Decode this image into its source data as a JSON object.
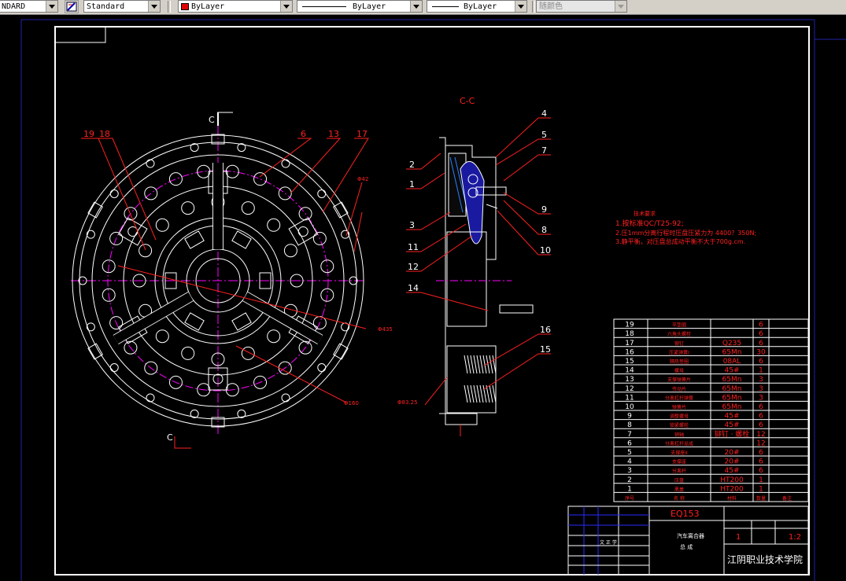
{
  "toolbar": {
    "text_style": "NDARD",
    "dim_style": "Standard",
    "layer_color": "ByLayer",
    "linetype": "ByLayer",
    "lineweight": "ByLayer",
    "plot_style": "随颜色"
  },
  "drawing": {
    "section_label": "C-C",
    "cut_label_top": "C",
    "cut_label_bottom": "C",
    "callouts_front": [
      "19",
      "18",
      "6",
      "13",
      "17"
    ],
    "callouts_section_left": [
      "2",
      "1",
      "3",
      "11",
      "12",
      "14"
    ],
    "callouts_section_right": [
      "4",
      "5",
      "7",
      "9",
      "8",
      "10",
      "16",
      "15"
    ],
    "dims": [
      "Φ435",
      "Φ160",
      "Φ83.25",
      "Φ42"
    ],
    "tech_notes_title": "技术要求",
    "tech_notes": [
      "1.按标准QC/T25-92;",
      "2.压1mm分离行程时压盘压紧力为 4400？350N;",
      "3.静平衡，对压盘总成动平衡不大于700g.cm."
    ]
  },
  "parts_list": {
    "rows": [
      {
        "no": "19",
        "name": "平垫圈",
        "material": "",
        "qty": "6"
      },
      {
        "no": "18",
        "name": "六角头螺栓",
        "material": "",
        "qty": "6"
      },
      {
        "no": "17",
        "name": "铆钉",
        "material": "Q235",
        "qty": "6"
      },
      {
        "no": "16",
        "name": "压紧弹簧I",
        "material": "65Mn",
        "qty": "30"
      },
      {
        "no": "15",
        "name": "隔热垫圈",
        "material": "08AL",
        "qty": "6"
      },
      {
        "no": "14",
        "name": "螺母",
        "material": "45#",
        "qty": "1"
      },
      {
        "no": "13",
        "name": "支撑弹簧片",
        "material": "65Mn",
        "qty": "3"
      },
      {
        "no": "12",
        "name": "传动片",
        "material": "65Mn",
        "qty": "3"
      },
      {
        "no": "11",
        "name": "分离杠杆弹簧",
        "material": "65Mn",
        "qty": "3"
      },
      {
        "no": "10",
        "name": "弹簧片",
        "material": "65Mn",
        "qty": "6"
      },
      {
        "no": "9",
        "name": "调整螺母",
        "material": "45#",
        "qty": "6"
      },
      {
        "no": "8",
        "name": "锁紧螺栓",
        "material": "45#",
        "qty": "6"
      },
      {
        "no": "7",
        "name": "销轴",
        "material": "铆钉 · 螺栓",
        "qty": "12"
      },
      {
        "no": "6",
        "name": "分离杠杆总成",
        "material": "",
        "qty": "12"
      },
      {
        "no": "5",
        "name": "支撑座II",
        "material": "20#",
        "qty": "6"
      },
      {
        "no": "4",
        "name": "支撑座",
        "material": "20#",
        "qty": "6"
      },
      {
        "no": "3",
        "name": "分离杆",
        "material": "45#",
        "qty": "6"
      },
      {
        "no": "2",
        "name": "压盘",
        "material": "HT200",
        "qty": "1"
      },
      {
        "no": "1",
        "name": "离盖",
        "material": "HT200",
        "qty": "1"
      }
    ],
    "header": [
      "序号",
      "名 称",
      "材料",
      "数量",
      "备注"
    ]
  },
  "title_block": {
    "drawing_no": "EQ153",
    "part_name": "汽车离合器",
    "part_sub": "总 成",
    "scale": "1",
    "sheet": "1:2",
    "designer": "文 正 学",
    "school": "江阴职业技术学院"
  },
  "colors": {
    "line": "#ffffff",
    "callout": "#ff0000",
    "center": "#ff00ff",
    "dim": "#ff2020",
    "section": "#00aaff",
    "frame": "#ffffff"
  }
}
